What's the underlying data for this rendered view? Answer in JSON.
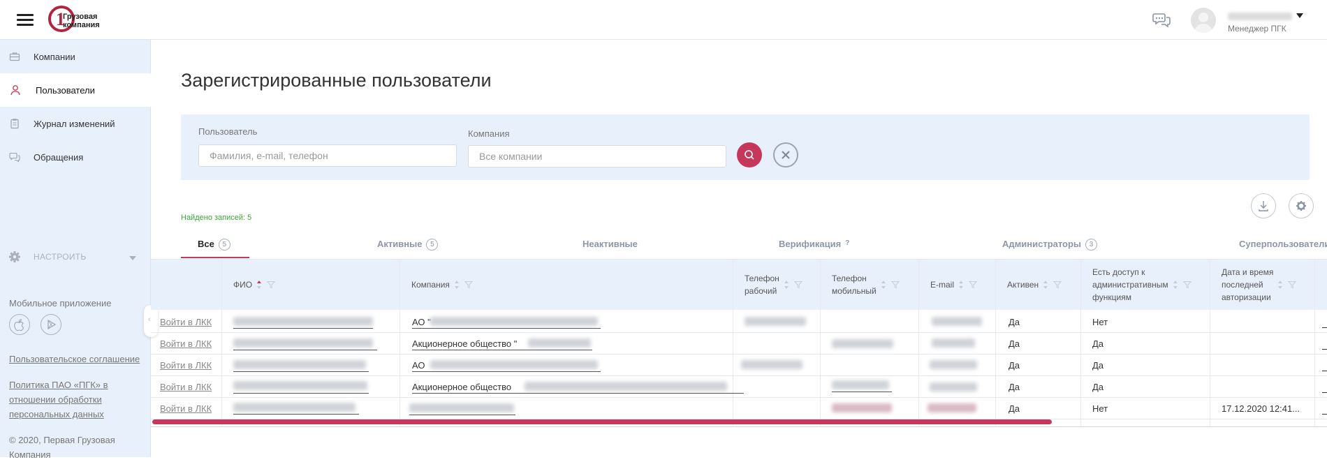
{
  "header": {
    "logo_text_line1": "Грузовая",
    "logo_text_line2": "компания",
    "logo_numeral": "1",
    "user_role": "Менеджер ПГК"
  },
  "sidebar": {
    "items": [
      {
        "label": "Компании",
        "icon": "briefcase-icon"
      },
      {
        "label": "Пользователи",
        "icon": "user-icon",
        "active": true
      },
      {
        "label": "Журнал изменений",
        "icon": "clipboard-icon"
      },
      {
        "label": "Обращения",
        "icon": "chat-icon"
      }
    ],
    "settings_label": "НАСТРОИТЬ",
    "mobile_title": "Мобильное приложение",
    "user_agreement": "Пользовательское соглашение",
    "policy_line1": "Политика ПАО «ПГК» в",
    "policy_line2": "отношении обработки",
    "policy_line3": "персональных данных",
    "copyright_line1": "© 2020, Первая Грузовая",
    "copyright_line2": "Компания"
  },
  "main": {
    "title": "Зарегистрированные пользователи",
    "filter": {
      "user_label": "Пользователь",
      "user_placeholder": "Фамилия, e-mail, телефон",
      "company_label": "Компания",
      "company_placeholder": "Все компании"
    },
    "found": "Найдено записей: 5",
    "tabs": [
      {
        "label": "Все",
        "count": "5"
      },
      {
        "label": "Активные",
        "count": "5"
      },
      {
        "label": "Неактивные"
      },
      {
        "label": "Верификация",
        "hint": "?"
      },
      {
        "label": "Администраторы",
        "count": "3"
      },
      {
        "label": "Суперпользователи"
      }
    ],
    "columns": {
      "fio": "ФИО",
      "company": "Компания",
      "work_phone_1": "Телефон",
      "work_phone_2": "рабочий",
      "mobile_phone_1": "Телефон",
      "mobile_phone_2": "мобильный",
      "email": "E-mail",
      "active": "Активен",
      "admin_1": "Есть доступ к",
      "admin_2": "административным",
      "admin_3": "функциям",
      "lastlogin_1": "Дата и время",
      "lastlogin_2": "последней",
      "lastlogin_3": "авторизации"
    },
    "rows": [
      {
        "action": "Войти в ЛКК",
        "company_prefix": "АО \"",
        "active": "Да",
        "admin": "Нет",
        "last_login": ""
      },
      {
        "action": "Войти в ЛКК",
        "company_prefix": "Акционерное общество \"",
        "active": "Да",
        "admin": "Да",
        "last_login": ""
      },
      {
        "action": "Войти в ЛКК",
        "company_prefix": "АО",
        "active": "Да",
        "admin": "Да",
        "last_login": ""
      },
      {
        "action": "Войти в ЛКК",
        "company_prefix": "Акционерное общество",
        "active": "Да",
        "admin": "Да",
        "last_login": ""
      },
      {
        "action": "Войти в ЛКК",
        "company_prefix": "",
        "active": "Да",
        "admin": "Нет",
        "last_login": "17.12.2020 12:41..."
      }
    ]
  },
  "colors": {
    "accent": "#c6385a",
    "panel": "#e8f0fb",
    "found": "#3aa53a"
  }
}
